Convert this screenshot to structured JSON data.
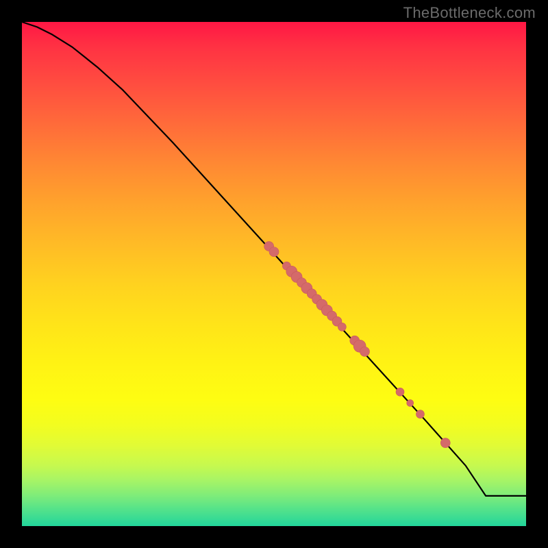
{
  "watermark": "TheBottleneck.com",
  "colors": {
    "line": "#000000",
    "point_fill": "#d46a6a",
    "point_stroke": "#c95b5b"
  },
  "chart_data": {
    "type": "line",
    "title": "",
    "xlabel": "",
    "ylabel": "",
    "xlim": [
      0,
      100
    ],
    "ylim": [
      0,
      100
    ],
    "series": [
      {
        "name": "curve",
        "x": [
          0,
          3,
          6,
          10,
          15,
          20,
          30,
          40,
          50,
          60,
          70,
          80,
          88,
          92,
          100
        ],
        "y": [
          100,
          99,
          97.5,
          95,
          91,
          86.5,
          76,
          65,
          54,
          43,
          32,
          21,
          12,
          6,
          6
        ]
      }
    ],
    "points": [
      {
        "x": 49.0,
        "y": 55.5,
        "r": 7
      },
      {
        "x": 50.0,
        "y": 54.4,
        "r": 7
      },
      {
        "x": 52.5,
        "y": 51.6,
        "r": 6
      },
      {
        "x": 53.5,
        "y": 50.5,
        "r": 8
      },
      {
        "x": 54.5,
        "y": 49.4,
        "r": 8
      },
      {
        "x": 55.5,
        "y": 48.3,
        "r": 7
      },
      {
        "x": 56.5,
        "y": 47.2,
        "r": 8
      },
      {
        "x": 57.5,
        "y": 46.1,
        "r": 7
      },
      {
        "x": 58.5,
        "y": 45.0,
        "r": 7
      },
      {
        "x": 59.5,
        "y": 43.9,
        "r": 8
      },
      {
        "x": 60.5,
        "y": 42.8,
        "r": 8
      },
      {
        "x": 61.5,
        "y": 41.7,
        "r": 7
      },
      {
        "x": 62.5,
        "y": 40.6,
        "r": 7
      },
      {
        "x": 63.5,
        "y": 39.5,
        "r": 6
      },
      {
        "x": 66.0,
        "y": 36.8,
        "r": 7
      },
      {
        "x": 67.0,
        "y": 35.7,
        "r": 9
      },
      {
        "x": 68.0,
        "y": 34.6,
        "r": 7
      },
      {
        "x": 75.0,
        "y": 26.6,
        "r": 6
      },
      {
        "x": 77.0,
        "y": 24.4,
        "r": 5
      },
      {
        "x": 79.0,
        "y": 22.2,
        "r": 6
      },
      {
        "x": 84.0,
        "y": 16.5,
        "r": 7
      }
    ]
  }
}
